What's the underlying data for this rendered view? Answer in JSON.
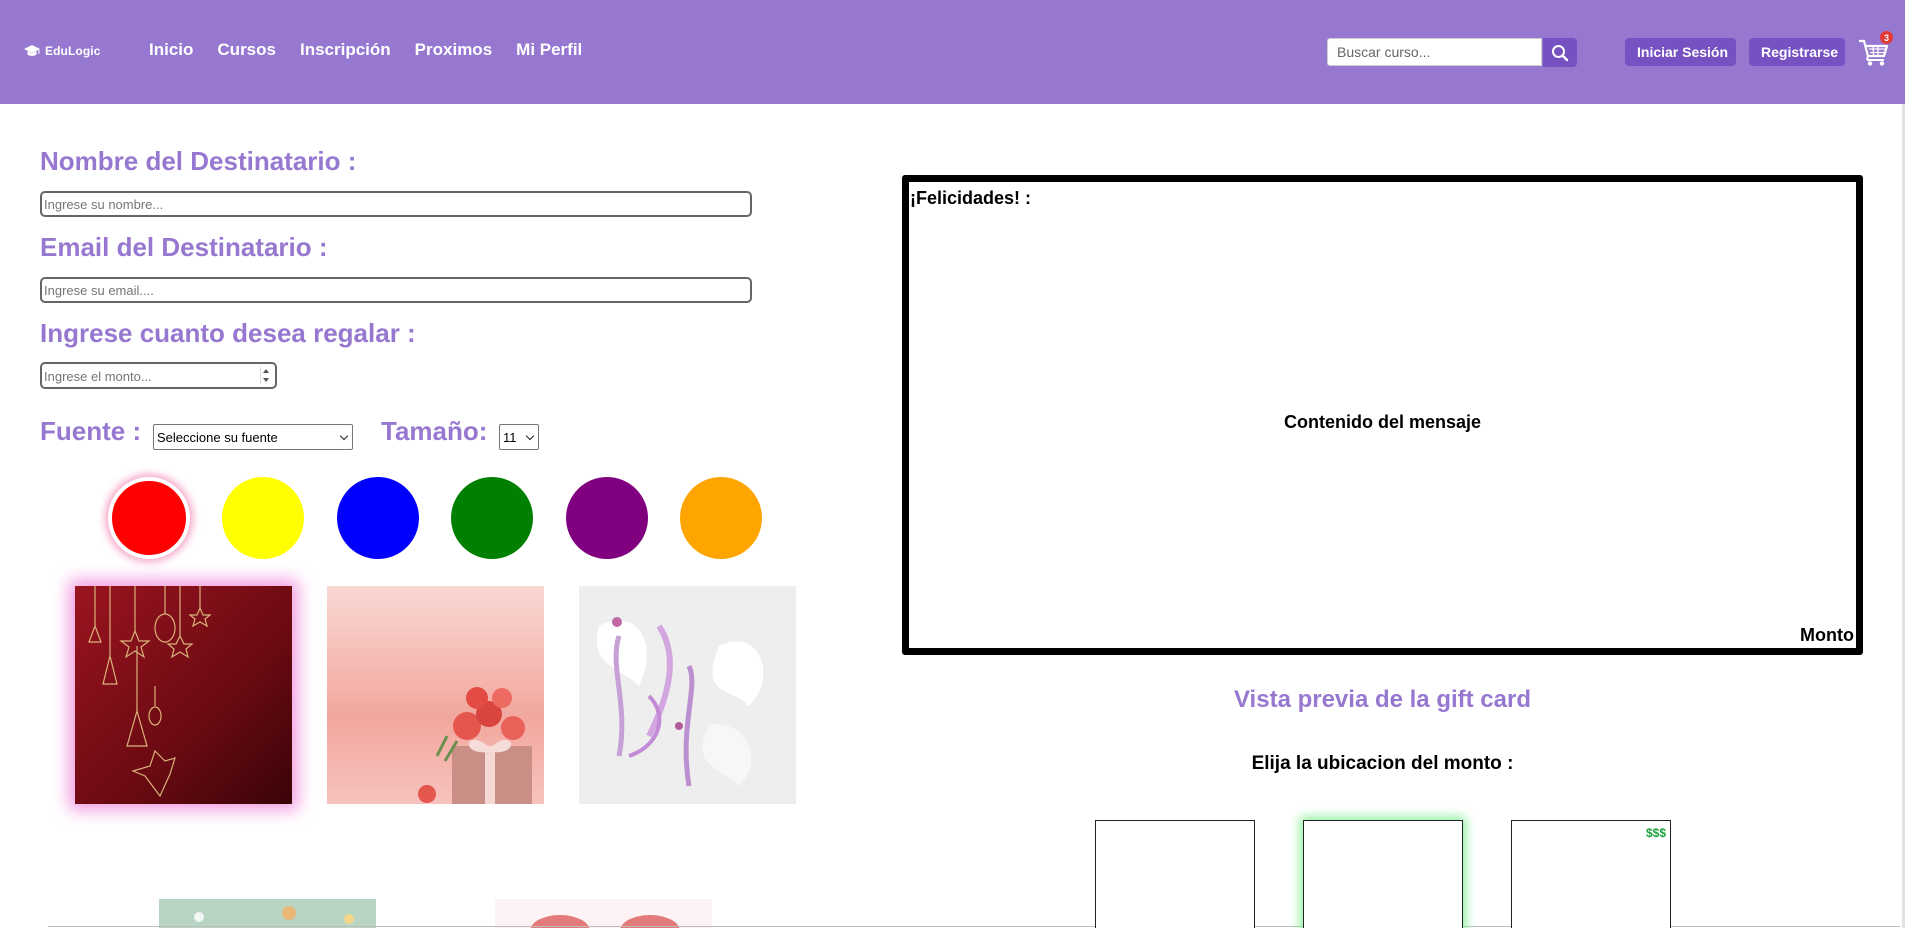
{
  "header": {
    "logo_text": "EduLogic",
    "nav": [
      "Inicio",
      "Cursos",
      "Inscripción",
      "Proximos",
      "Mi Perfil"
    ],
    "search_placeholder": "Buscar curso...",
    "login_label": "Iniciar Sesión",
    "register_label": "Registrarse",
    "cart_count": "3"
  },
  "form": {
    "recipient_name_label": "Nombre del Destinatario :",
    "recipient_name_placeholder": "Ingrese su nombre...",
    "recipient_email_label": "Email del Destinatario :",
    "recipient_email_placeholder": "Ingrese su email....",
    "amount_label": "Ingrese cuanto desea regalar :",
    "amount_placeholder": "Ingrese el monto...",
    "font_label": "Fuente :",
    "font_select_value": "Seleccione su fuente",
    "size_label": "Tamaño:",
    "size_select_value": "11"
  },
  "colors": [
    {
      "name": "red",
      "hex": "#ff0000",
      "selected": true
    },
    {
      "name": "yellow",
      "hex": "#ffff00",
      "selected": false
    },
    {
      "name": "blue",
      "hex": "#0000ff",
      "selected": false
    },
    {
      "name": "green",
      "hex": "#008000",
      "selected": false
    },
    {
      "name": "purple",
      "hex": "#800080",
      "selected": false
    },
    {
      "name": "orange",
      "hex": "#ffa500",
      "selected": false
    }
  ],
  "backgrounds": [
    {
      "name": "christmas-ornaments",
      "selected": true
    },
    {
      "name": "pink-roses-gift",
      "selected": false
    },
    {
      "name": "white-lilies",
      "selected": false
    }
  ],
  "preview": {
    "card_title": "¡Felicidades! :",
    "card_message": "Contenido del mensaje",
    "card_amount": "Monto",
    "preview_title": "Vista previa de la gift card",
    "location_title": "Elija la ubicacion del monto :",
    "location_marker": "$$$"
  },
  "theme": {
    "primary": "#9778d0",
    "button": "#7551c2"
  }
}
